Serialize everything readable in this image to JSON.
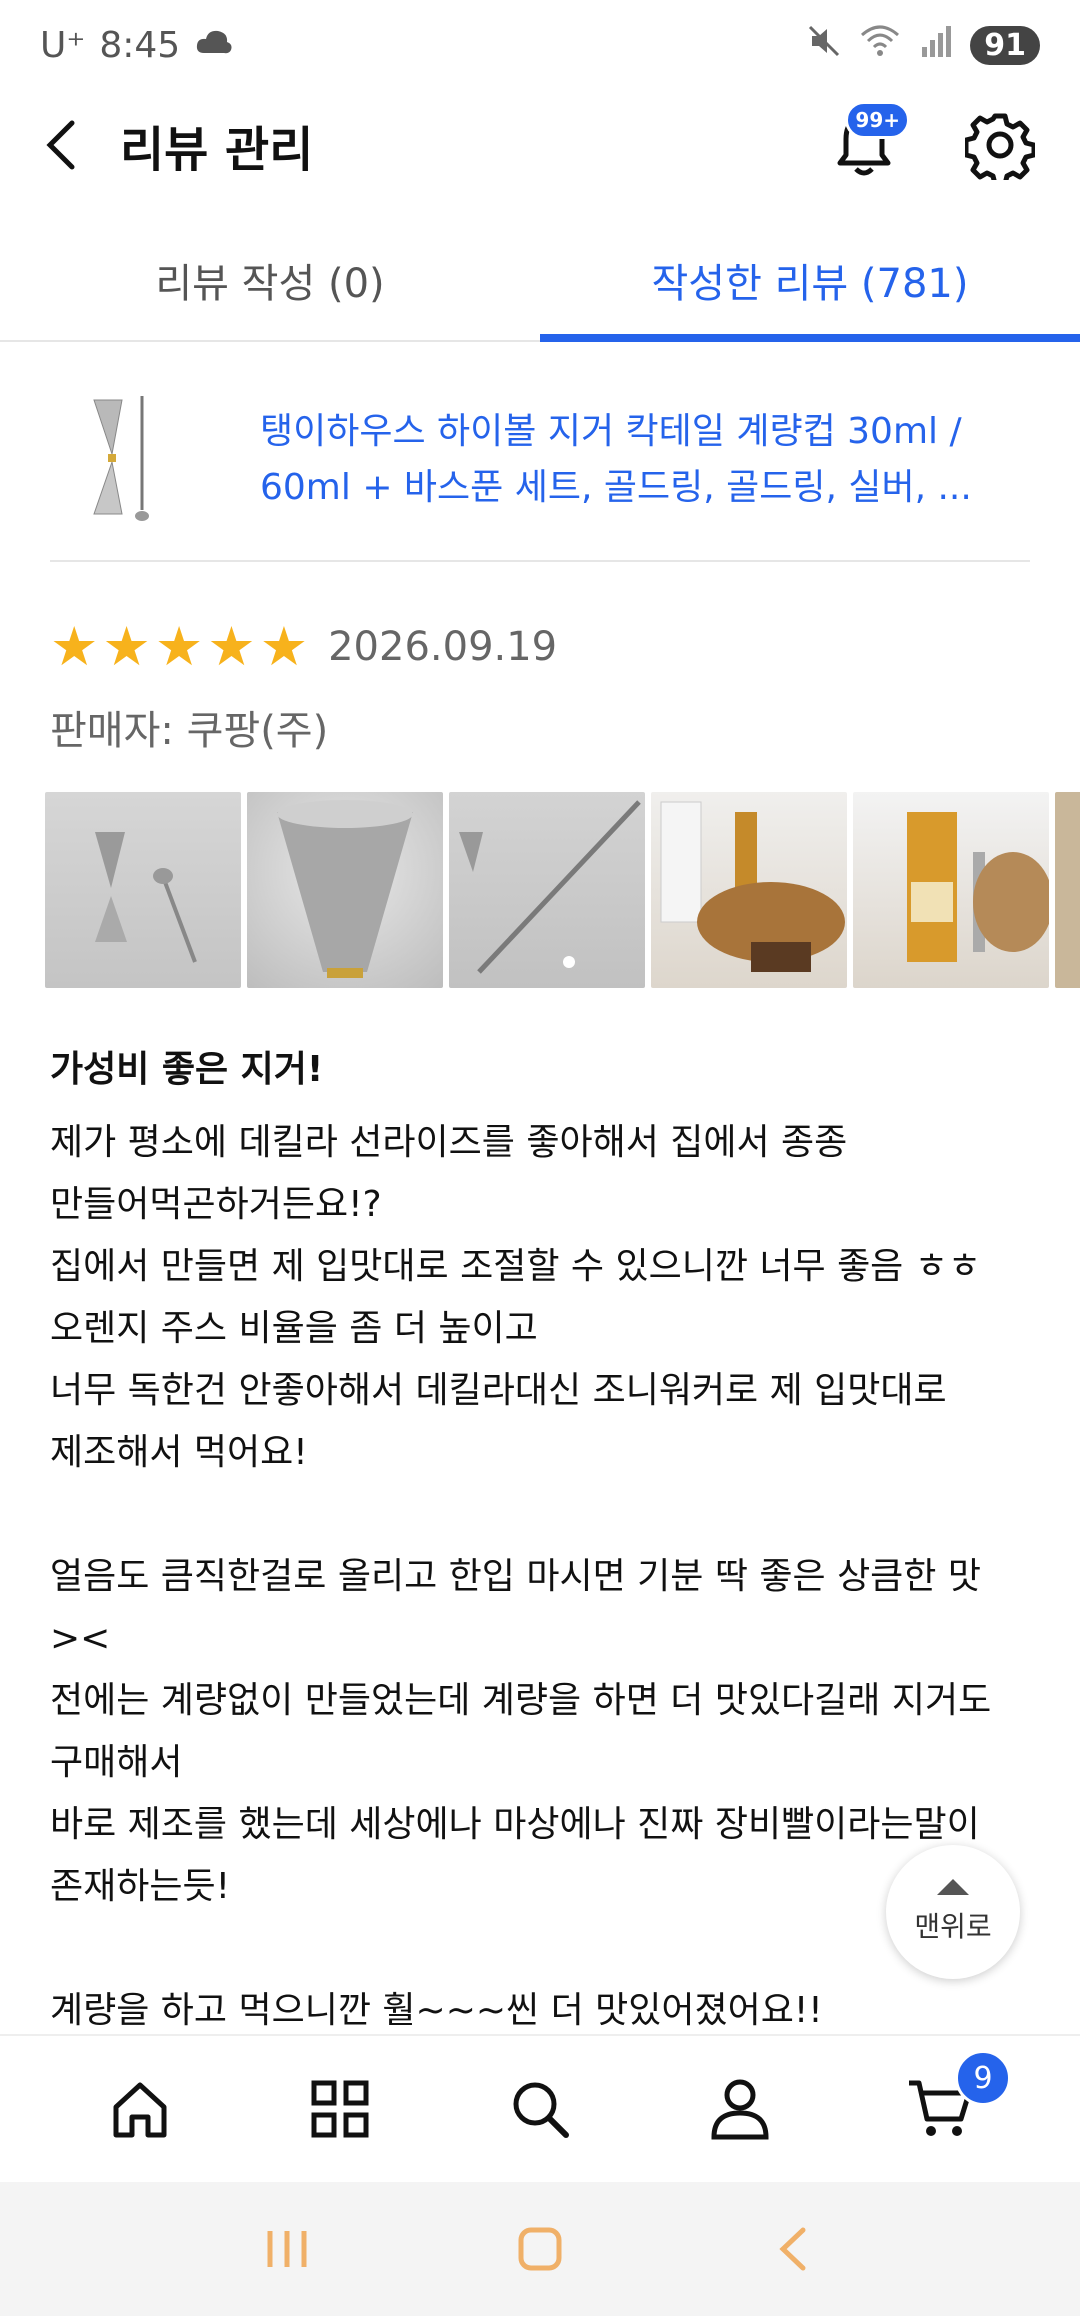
{
  "status": {
    "carrier": "U⁺",
    "time": "8:45",
    "battery": "91"
  },
  "header": {
    "title": "리뷰 관리",
    "notif_badge": "99+"
  },
  "tabs": [
    {
      "label": "리뷰 작성 (0)",
      "active": false
    },
    {
      "label": "작성한 리뷰 (781)",
      "active": true
    }
  ],
  "product": {
    "name": "탱이하우스 하이볼 지거 칵테일 계량컵 30ml / 60ml + 바스푼 세트, 골드링, 골드링, 실버, ..."
  },
  "review": {
    "rating": 5,
    "date": "2026.09.19",
    "seller": "판매자: 쿠팡(주)",
    "title": "가성비 좋은 지거!",
    "lines": [
      "제가 평소에 데킬라 선라이즈를 좋아해서 집에서 종종",
      "만들어먹곤하거든요!?",
      "집에서 만들면 제 입맛대로 조절할 수 있으니깐 너무 좋음 ㅎㅎ",
      "오렌지 주스 비율을 좀 더 높이고",
      "너무 독한건 안좋아해서 데킬라대신 조니워커로 제 입맛대로",
      "제조해서 먹어요!",
      "",
      "얼음도 큼직한걸로 올리고 한입 마시면 기분 딱 좋은 상큼한 맛",
      "><",
      "전에는 계량없이 만들었는데 계량을 하면 더 맛있다길래 지거도",
      "구매해서",
      "바로 제조를 했는데 세상에나 마상에나 진짜 장비빨이라는말이",
      "존재하는듯!",
      "",
      "계량을 하고 먹으니깐 훨~~~씬 더 맛있어졌어요!!"
    ]
  },
  "top_button": {
    "label": "맨위로"
  },
  "bottom_nav": {
    "cart_count": "9"
  },
  "colors": {
    "accent": "#2563eb",
    "star": "#f7b21c"
  }
}
